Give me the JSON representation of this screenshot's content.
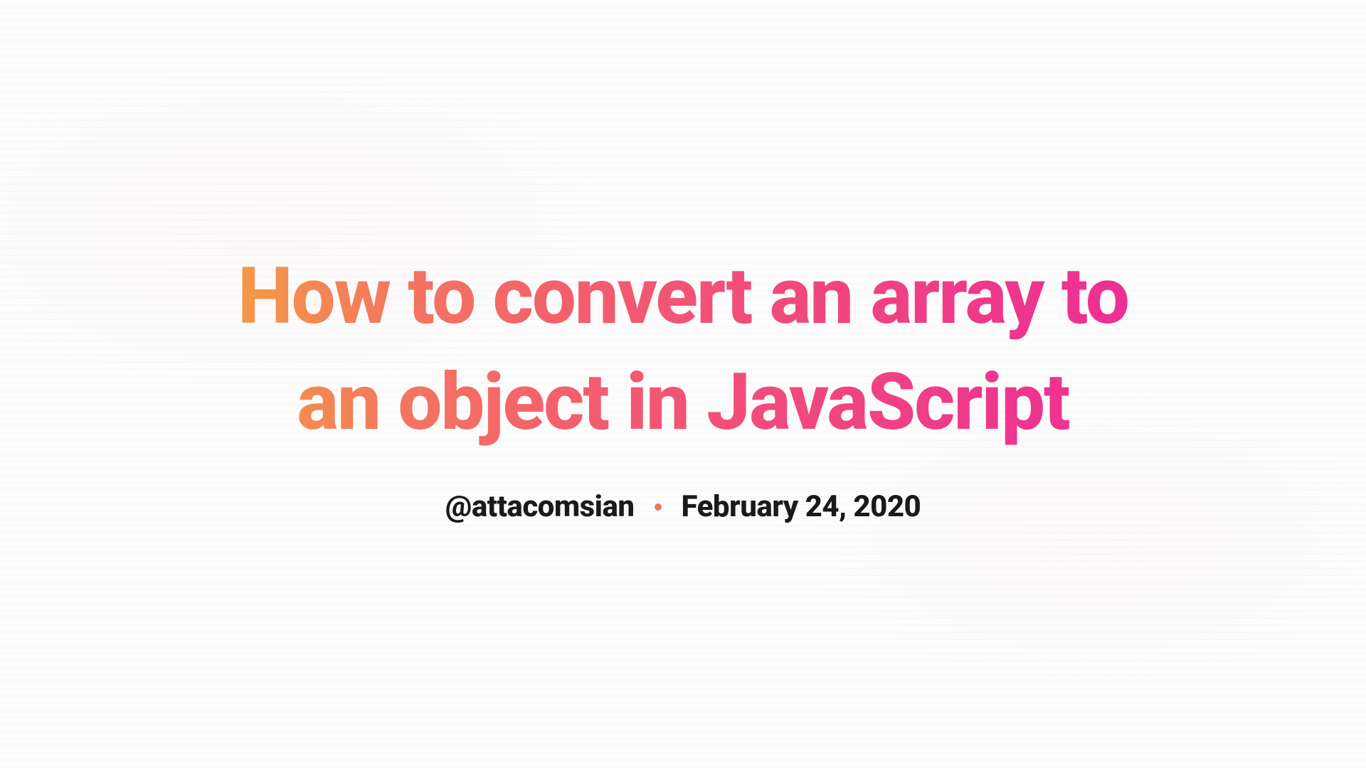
{
  "article": {
    "title": "How to convert an array to an object in JavaScript",
    "author": "@attacomsian",
    "date": "February 24, 2020"
  }
}
